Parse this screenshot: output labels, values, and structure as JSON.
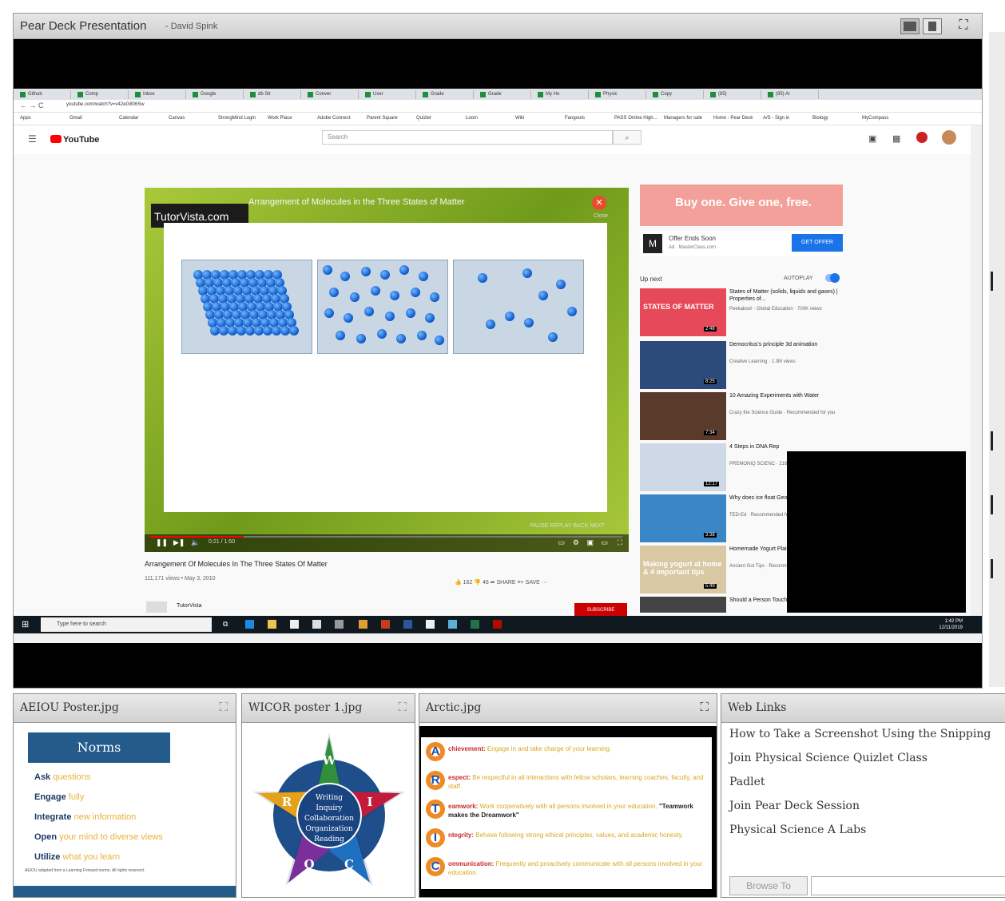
{
  "main_window": {
    "title": "Pear Deck Presentation",
    "subtitle": "- David Spink"
  },
  "browser": {
    "tabs": [
      "Github",
      "Comp",
      "Inbox",
      "Google",
      "db Str",
      "Conver",
      "User",
      "Grade",
      "Grade",
      "My Ho",
      "Physic",
      "Copy",
      "(85)",
      "(85) Ar"
    ],
    "url": "youtube.com/watch?v=v42eG806Sw",
    "bookmarks": [
      "Apps",
      "Gmail",
      "Calendar",
      "Canvas",
      "StrongMind Login",
      "Work Place",
      "Adobe Connect",
      "Parent Square",
      "Quizlet",
      "Loom",
      "Wiki",
      "Fangouts",
      "PASS Online High...",
      "Managers for sale",
      "Home - Pear Deck",
      "A/S - Sign in",
      "Biology",
      "MyCompass"
    ]
  },
  "youtube": {
    "logo": "YouTube",
    "search_placeholder": "Search",
    "video": {
      "brand": "TutorVista.com",
      "overlay_title": "Arrangement of Molecules in the Three States of Matter",
      "close_label": "Close",
      "nav_labels": "PAUSE  REPLAY  BACK  NEXT",
      "time": "0:21 / 1:50",
      "progress": 0.2,
      "title": "Arrangement Of Molecules In The Three States Of Matter",
      "meta": "111,171 views • May 3, 2010",
      "actions": "👍 162    👎 46    ➦ SHARE    ≡+ SAVE    ···",
      "channel": "TutorVista",
      "subscribe": "SUBSCRIBE"
    },
    "ad": {
      "headline": "Buy one. Give one, free.",
      "offer": "Offer Ends Soon",
      "sponsor": "Ad · MasterClass.com",
      "button": "GET OFFER"
    },
    "up_next": "Up next",
    "autoplay": "AUTOPLAY",
    "recommendations": [
      {
        "title": "States of Matter (solids, liquids and gases) | Properties of...",
        "meta": "Peekaboo! · Global Education · 700K views",
        "duration": "2:48",
        "thumb_color": "#e64a5a",
        "thumb_text": "STATES OF MATTER"
      },
      {
        "title": "Democritus's principle 3d animation",
        "meta": "Creative Learning · 1.3M views",
        "duration": "8:25",
        "thumb_color": "#2c4a7a",
        "thumb_text": ""
      },
      {
        "title": "10 Amazing Experiments with Water",
        "meta": "Crazy the Science Guide · Recommended for you",
        "duration": "7:34",
        "thumb_color": "#5a3a2a",
        "thumb_text": ""
      },
      {
        "title": "4 Steps in DNA Rep",
        "meta": "PREMONIQ SCIENC · 216K views",
        "duration": "12:17",
        "thumb_color": "#cfd8e6",
        "thumb_text": ""
      },
      {
        "title": "Why does ice float George Zaidan and",
        "meta": "TED-Ed · Recommended for y",
        "duration": "3:38",
        "thumb_color": "#3a87c8",
        "thumb_text": ""
      },
      {
        "title": "Homemade Yogurt Plain, 4 Tips You've",
        "meta": "Ancient Gut Tips · Recommended for y",
        "duration": "5:49",
        "thumb_color": "#d8c9a4",
        "thumb_text": "Making yogurt at home & 4 important tips"
      },
      {
        "title": "Should a Person Touch 100,000",
        "meta": "",
        "duration": "",
        "thumb_color": "#444",
        "thumb_text": ""
      }
    ]
  },
  "taskbar": {
    "search": "Type here to search",
    "time": "1:42 PM",
    "date": "12/11/2019"
  },
  "widgets": {
    "aeiou": {
      "title": "AEIOU Poster.jpg",
      "heading": "Norms",
      "items": [
        {
          "bold": "Ask",
          "rest": "questions"
        },
        {
          "bold": "Engage",
          "rest": "fully"
        },
        {
          "bold": "Integrate",
          "rest": "new information"
        },
        {
          "bold": "Open",
          "rest": "your mind to diverse views"
        },
        {
          "bold": "Utilize",
          "rest": "what you learn"
        }
      ],
      "footer": "AEIOU adapted from a Learning Forward norms. All rights reserved."
    },
    "wicor": {
      "title": "WICOR poster 1.jpg",
      "center_lines": [
        "Writing",
        "Inquiry",
        "Collaboration",
        "Organization",
        "Reading"
      ],
      "letters": [
        "W",
        "I",
        "C",
        "O",
        "R"
      ]
    },
    "arctic": {
      "title": "Arctic.jpg",
      "rows": [
        {
          "letter": "A",
          "key": "chievement:",
          "text": "Engage in and take charge of your learning.",
          "quote": ""
        },
        {
          "letter": "R",
          "key": "espect:",
          "text": "Be respectful in all interactions with fellow scholars, learning coaches, faculty, and staff.",
          "quote": ""
        },
        {
          "letter": "T",
          "key": "eamwork:",
          "text": "Work cooperatively with all persons involved in your education.",
          "quote": "\"Teamwork makes the Dreamwork\""
        },
        {
          "letter": "I",
          "key": "ntegrity:",
          "text": "Behave following strong ethical principles, values, and academic honesty.",
          "quote": ""
        },
        {
          "letter": "C",
          "key": "ommunication:",
          "text": "Frequently and proactively communicate with all persons involved in your education.",
          "quote": ""
        }
      ]
    },
    "web_links": {
      "title": "Web Links",
      "links": [
        "How to Take a Screenshot Using the Snipping",
        "Join Physical Science Quizlet Class",
        "Padlet",
        "Join Pear Deck Session",
        "Physical Science A Labs"
      ],
      "browse_button": "Browse To"
    }
  },
  "colors": {
    "accent_blue": "#235b8a",
    "youtube_red": "#ff0000",
    "video_green": "#8db32a",
    "arctic_orange": "#f08a24"
  }
}
